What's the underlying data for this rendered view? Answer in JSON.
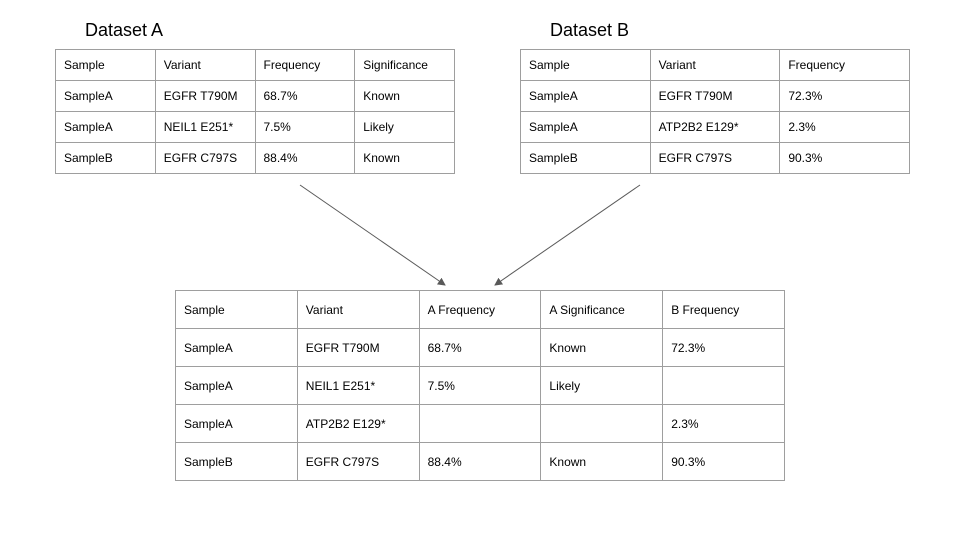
{
  "datasetA": {
    "title": "Dataset A",
    "headers": [
      "Sample",
      "Variant",
      "Frequency",
      "Significance"
    ],
    "rows": [
      [
        "SampleA",
        "EGFR T790M",
        "68.7%",
        "Known"
      ],
      [
        "SampleA",
        "NEIL1 E251*",
        "7.5%",
        "Likely"
      ],
      [
        "SampleB",
        "EGFR C797S",
        "88.4%",
        "Known"
      ]
    ]
  },
  "datasetB": {
    "title": "Dataset B",
    "headers": [
      "Sample",
      "Variant",
      "Frequency"
    ],
    "rows": [
      [
        "SampleA",
        "EGFR T790M",
        "72.3%"
      ],
      [
        "SampleA",
        "ATP2B2 E129*",
        "2.3%"
      ],
      [
        "SampleB",
        "EGFR C797S",
        "90.3%"
      ]
    ]
  },
  "merged": {
    "headers": [
      "Sample",
      "Variant",
      "A Frequency",
      "A Significance",
      "B Frequency"
    ],
    "rows": [
      [
        "SampleA",
        "EGFR T790M",
        "68.7%",
        "Known",
        "72.3%"
      ],
      [
        "SampleA",
        "NEIL1 E251*",
        "7.5%",
        "Likely",
        ""
      ],
      [
        "SampleA",
        "ATP2B2 E129*",
        "",
        "",
        "2.3%"
      ],
      [
        "SampleB",
        "EGFR C797S",
        "88.4%",
        "Known",
        "90.3%"
      ]
    ]
  }
}
